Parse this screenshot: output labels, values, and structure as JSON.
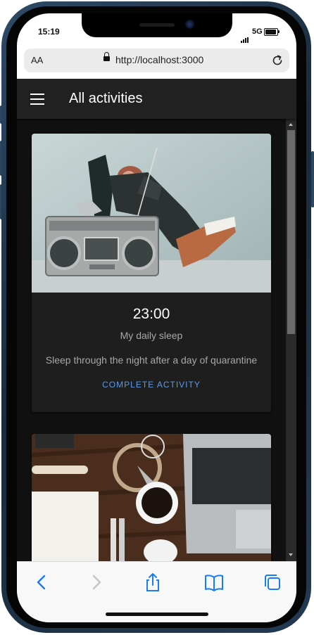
{
  "status_bar": {
    "time": "15:19",
    "network": "5G"
  },
  "browser": {
    "text_size_label": "AA",
    "url": "http://localhost:3000"
  },
  "app": {
    "title": "All activities",
    "activities": [
      {
        "time": "23:00",
        "name": "My daily sleep",
        "description": "Sleep through the night after a day of quarantine",
        "action_label": "COMPLETE ACTIVITY",
        "image": "person-relaxing-with-boombox"
      },
      {
        "image": "desk-with-coffee-laptop-notebook"
      }
    ]
  },
  "toolbar": {
    "icons": [
      "back-icon",
      "forward-icon",
      "share-icon",
      "bookmarks-icon",
      "tabs-icon"
    ]
  },
  "colors": {
    "app_background": "#111111",
    "app_bar": "#212121",
    "card": "#1e1e1e",
    "accent": "#5b9ce6",
    "ios_blue": "#1a7cf5"
  }
}
